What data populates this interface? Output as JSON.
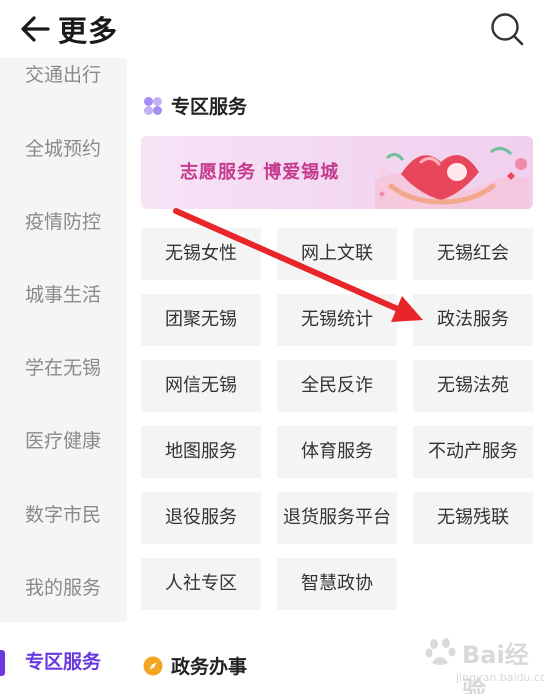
{
  "header": {
    "title": "更多",
    "back_icon": "arrow-left-icon",
    "search_icon": "search-icon"
  },
  "sidebar": {
    "items": [
      {
        "label": "交通出行"
      },
      {
        "label": "全城预约"
      },
      {
        "label": "疫情防控"
      },
      {
        "label": "城事生活"
      },
      {
        "label": "学在无锡"
      },
      {
        "label": "医疗健康"
      },
      {
        "label": "数字市民"
      },
      {
        "label": "我的服务"
      },
      {
        "label": "专区服务",
        "active": true
      }
    ],
    "active_color": "#6a39e0"
  },
  "main": {
    "section1": {
      "title": "专区服务",
      "icon": "grid-icon"
    },
    "banner": {
      "text": "志愿服务  博爱锡城",
      "art": "heart-in-hands-illustration"
    },
    "services": [
      [
        "无锡女性",
        "网上文联",
        "无锡红会"
      ],
      [
        "团聚无锡",
        "无锡统计",
        "政法服务"
      ],
      [
        "网信无锡",
        "全民反诈",
        "无锡法苑"
      ],
      [
        "地图服务",
        "体育服务",
        "不动产服务"
      ],
      [
        "退役服务",
        "退货服务平台",
        "无锡残联"
      ],
      [
        "人社专区",
        "智慧政协"
      ]
    ],
    "section2": {
      "title": "政务办事",
      "icon": "compass-icon"
    }
  },
  "annotation": {
    "type": "red-arrow",
    "color": "#e8262a",
    "points_to": "政法服务"
  },
  "watermark": {
    "text": "Bai经验",
    "sub": "jingyan.baidu.com"
  }
}
